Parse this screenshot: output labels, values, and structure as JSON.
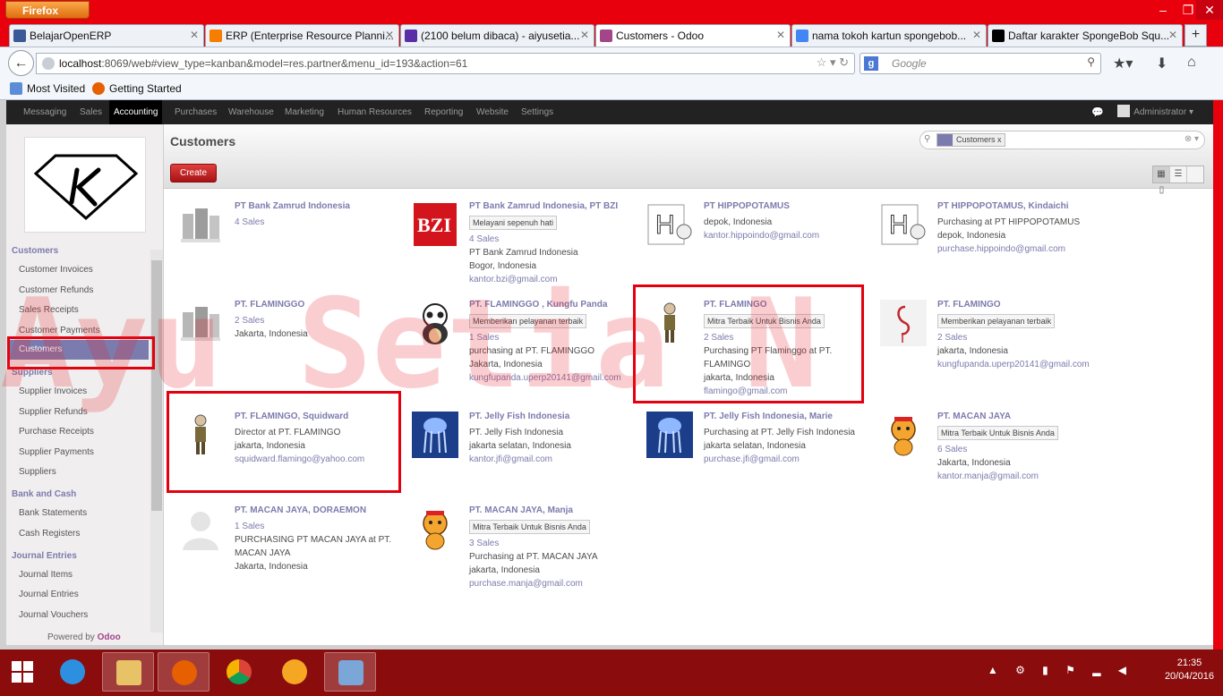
{
  "browser": {
    "app_button": "Firefox",
    "tabs": [
      {
        "label": "BelajarOpenERP",
        "color": "#3b5998"
      },
      {
        "label": "ERP (Enterprise Resource Planni...",
        "color": "#f57d00"
      },
      {
        "label": "(2100 belum dibaca) - aiyusetia...",
        "color": "#5a2ea6"
      },
      {
        "label": "Customers - Odoo",
        "color": "#a24689"
      },
      {
        "label": "nama tokoh kartun spongebob...",
        "color": "#4285f4"
      },
      {
        "label": "Daftar karakter SpongeBob Squ...",
        "color": "#000000"
      }
    ],
    "url_host": "localhost",
    "url_rest": ":8069/web#view_type=kanban&model=res.partner&menu_id=193&action=61",
    "search_placeholder": "Google",
    "bookmarks": [
      "Most Visited",
      "Getting Started"
    ]
  },
  "odoo": {
    "menus": [
      "Messaging",
      "Sales",
      "Accounting",
      "Purchases",
      "Warehouse",
      "Marketing",
      "Human Resources",
      "Reporting",
      "Website",
      "Settings"
    ],
    "user": "Administrator",
    "page_title": "Customers",
    "create_label": "Create",
    "search_facet": "Customers",
    "sidebar": {
      "customers_header": "Customers",
      "customers_items": [
        "Customer Invoices",
        "Customer Refunds",
        "Sales Receipts",
        "Customer Payments",
        "Customers"
      ],
      "suppliers_header": "Suppliers",
      "suppliers_items": [
        "Supplier Invoices",
        "Supplier Refunds",
        "Purchase Receipts",
        "Supplier Payments",
        "Suppliers"
      ],
      "bank_header": "Bank and Cash",
      "bank_items": [
        "Bank Statements",
        "Cash Registers"
      ],
      "journal_header": "Journal Entries",
      "journal_items": [
        "Journal Items",
        "Journal Entries",
        "Journal Vouchers"
      ],
      "powered_prefix": "Powered by",
      "powered_brand": "Odoo"
    },
    "cards": [
      {
        "name": "PT Bank Zamrud Indonesia",
        "tag": "",
        "sales": "4 Sales",
        "lines": [],
        "email": "",
        "avatar": "building"
      },
      {
        "name": "PT Bank Zamrud Indonesia, PT BZI",
        "tag": "Melayani sepenuh hati",
        "sales": "4 Sales",
        "lines": [
          "PT Bank Zamrud Indonesia",
          "Bogor, Indonesia"
        ],
        "email": "kantor.bzi@gmail.com",
        "avatar": "bzi"
      },
      {
        "name": "PT HIPPOPOTAMUS",
        "tag": "",
        "sales": "",
        "lines": [
          "depok, Indonesia"
        ],
        "email": "kantor.hippoindo@gmail.com",
        "avatar": "hippo"
      },
      {
        "name": "PT HIPPOPOTAMUS, Kindaichi",
        "tag": "",
        "sales": "",
        "lines": [
          "Purchasing at PT HIPPOPOTAMUS",
          "depok, Indonesia"
        ],
        "email": "purchase.hippoindo@gmail.com",
        "avatar": "hippo"
      },
      {
        "name": "PT. FLAMINGGO",
        "tag": "",
        "sales": "2 Sales",
        "lines": [
          "Jakarta, Indonesia"
        ],
        "email": "",
        "avatar": "building"
      },
      {
        "name": "PT. FLAMINGGO , Kungfu Panda",
        "tag": "Memberikan pelayanan terbaik",
        "sales": "1 Sales",
        "lines": [
          "purchasing at PT. FLAMINGGO",
          "Jakarta, Indonesia"
        ],
        "email": "kungfupanda.uperp20141@gmail.com",
        "avatar": "panda"
      },
      {
        "name": "PT. FLAMINGO",
        "tag": "Mitra Terbaik Untuk Bisnis Anda",
        "sales": "2 Sales",
        "lines": [
          "Purchasing PT Flaminggo at PT. FLAMINGO",
          "jakarta, Indonesia"
        ],
        "email": "flamingo@gmail.com",
        "avatar": "person"
      },
      {
        "name": "PT. FLAMINGO",
        "tag": "Memberikan pelayanan terbaik",
        "sales": "2 Sales",
        "lines": [
          "jakarta, Indonesia"
        ],
        "email": "kungfupanda.uperp20141@gmail.com",
        "avatar": "flamingo"
      },
      {
        "name": "PT. FLAMINGO, Squidward",
        "tag": "",
        "sales": "",
        "lines": [
          "Director at PT. FLAMINGO",
          "jakarta, Indonesia"
        ],
        "email": "squidward.flamingo@yahoo.com",
        "avatar": "person"
      },
      {
        "name": "PT. Jelly Fish Indonesia",
        "tag": "",
        "sales": "",
        "lines": [
          "PT. Jelly Fish Indonesia",
          "jakarta selatan, Indonesia"
        ],
        "email": "kantor.jfi@gmail.com",
        "avatar": "jelly"
      },
      {
        "name": "PT. Jelly Fish Indonesia, Marie",
        "tag": "",
        "sales": "",
        "lines": [
          "Purchasing at PT. Jelly Fish Indonesia",
          "jakarta selatan, Indonesia"
        ],
        "email": "purchase.jfi@gmail.com",
        "avatar": "jelly"
      },
      {
        "name": "PT. MACAN JAYA",
        "tag": "Mitra Terbaik Untuk Bisnis Anda",
        "sales": "6 Sales",
        "lines": [
          "Jakarta, Indonesia"
        ],
        "email": "kantor.manja@gmail.com",
        "avatar": "tiger"
      },
      {
        "name": "PT. MACAN JAYA, DORAEMON",
        "tag": "",
        "sales": "1 Sales",
        "lines": [
          "PURCHASING PT MACAN JAYA at PT. MACAN JAYA",
          "Jakarta, Indonesia"
        ],
        "email": "",
        "avatar": "blank"
      },
      {
        "name": "PT. MACAN JAYA, Manja",
        "tag": "Mitra Terbaik Untuk Bisnis Anda",
        "sales": "3 Sales",
        "lines": [
          "Purchasing at PT. MACAN JAYA",
          "jakarta, Indonesia"
        ],
        "email": "purchase.manja@gmail.com",
        "avatar": "tiger"
      }
    ]
  },
  "watermark": "Ayu Setia N",
  "taskbar": {
    "time": "21:35",
    "date": "20/04/2016"
  }
}
